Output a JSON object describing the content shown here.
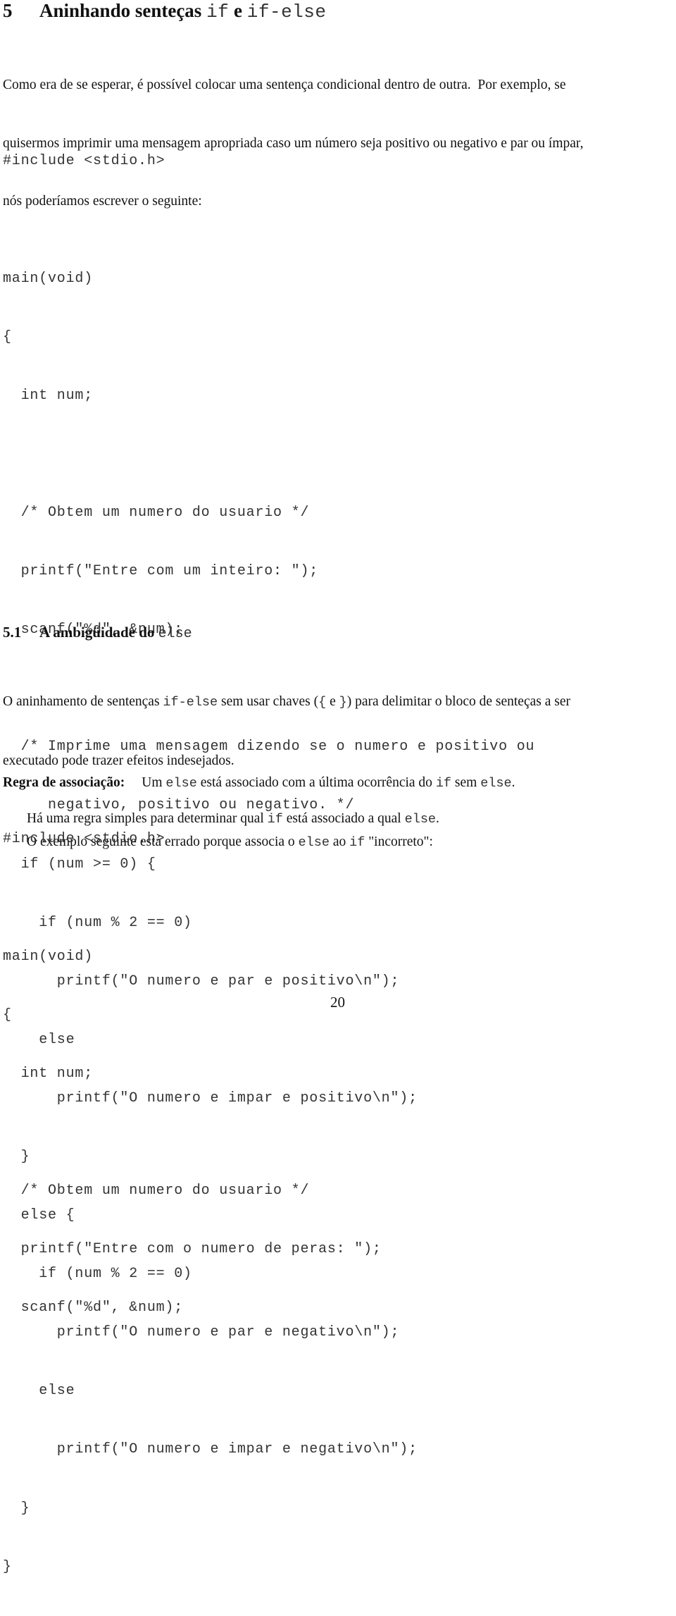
{
  "section": {
    "number": "5",
    "title_part1": "Aninhando senteças",
    "title_code1": "if",
    "title_part2": "e",
    "title_code2": "if-else"
  },
  "intro": {
    "lines": [
      "Como era de se esperar, é possível colocar uma sentença condicional dentro de outra.  Por exemplo, se",
      "quisermos imprimir uma mensagem apropriada caso um número seja positivo ou negativo e par ou ímpar,",
      "nós poderíamos escrever o seguinte:"
    ]
  },
  "code_block_1": {
    "lines": [
      "#include <stdio.h>",
      "",
      "main(void)",
      "{",
      "  int num;",
      "",
      "  /* Obtem um numero do usuario */",
      "  printf(\"Entre com um inteiro: \");",
      "  scanf(\"%d\", &num);",
      "",
      "  /* Imprime uma mensagem dizendo se o numero e positivo ou",
      "     negativo, positivo ou negativo. */",
      "  if (num >= 0) {",
      "    if (num % 2 == 0)",
      "      printf(\"O numero e par e positivo\\n\");",
      "    else",
      "      printf(\"O numero e impar e positivo\\n\");",
      "  }",
      "  else {",
      "    if (num % 2 == 0)",
      "      printf(\"O numero e par e negativo\\n\");",
      "    else",
      "      printf(\"O numero e impar e negativo\\n\");",
      "  }",
      "}"
    ]
  },
  "subsection": {
    "number": "5.1",
    "title_text": "A ambigüidade do",
    "title_code": "else"
  },
  "para_ambiguity": {
    "l1_a": "O aninhamento de sentenças ",
    "l1_code1": "if-else",
    "l1_b": " sem usar chaves (",
    "l1_code2": "{",
    "l1_c": " e ",
    "l1_code3": "}",
    "l1_d": ") para delimitar o bloco de senteças a ser",
    "l2": "executado pode trazer efeitos indesejados.",
    "l3_a": "Há uma regra simples para determinar qual ",
    "l3_code1": "if",
    "l3_b": " está associado a qual ",
    "l3_code2": "else",
    "l3_c": "."
  },
  "rule": {
    "label": "Regra de associação:",
    "text_a": "Um ",
    "code1": "else",
    "text_b": " está associado com a última ocorrência do ",
    "code2": "if",
    "text_c": " sem ",
    "code3": "else",
    "text_d": "."
  },
  "example_intro": {
    "text_a": "O exemplo seguinte está errado porque associa o ",
    "code1": "else",
    "text_b": " ao ",
    "code2": "if",
    "text_c": " \"incorreto\":"
  },
  "code_block_2": {
    "lines": [
      "#include <stdio.h>",
      "",
      "main(void)",
      "{",
      "  int num;",
      "",
      "  /* Obtem um numero do usuario */",
      "  printf(\"Entre com o numero de peras: \");",
      "  scanf(\"%d\", &num);"
    ]
  },
  "footer": {
    "page_number": "20"
  }
}
